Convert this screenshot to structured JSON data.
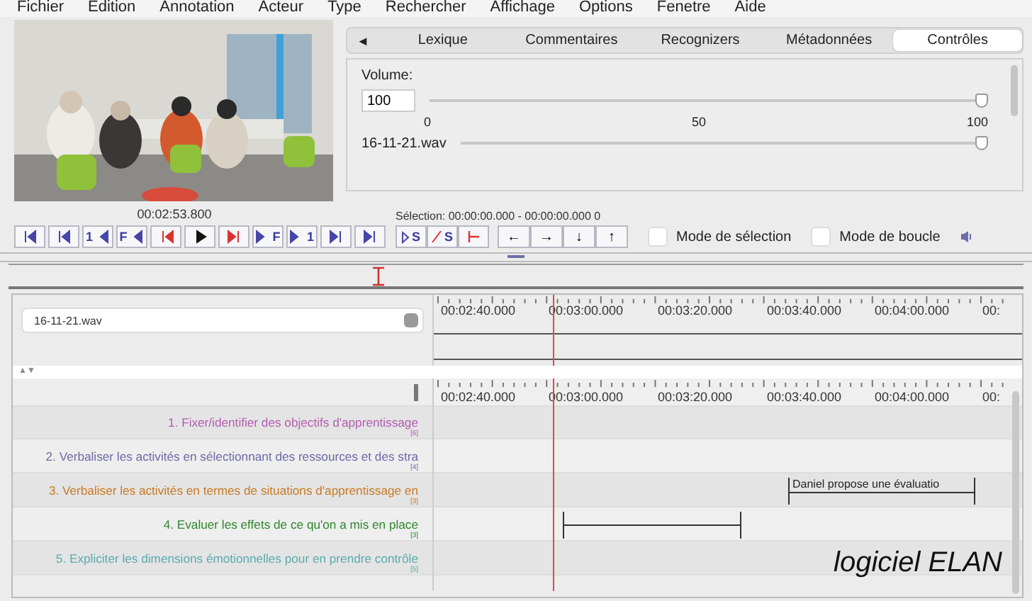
{
  "menu": [
    "Fichier",
    "Edition",
    "Annotation",
    "Acteur",
    "Type",
    "Rechercher",
    "Affichage",
    "Options",
    "Fenetre",
    "Aide"
  ],
  "player": {
    "time": "00:02:53.800",
    "buttons": [
      {
        "kind": "first"
      },
      {
        "kind": "prev-second"
      },
      {
        "kind": "prev-step",
        "label": "1"
      },
      {
        "kind": "prev-frame",
        "label": "F"
      },
      {
        "kind": "prev-boundary"
      },
      {
        "kind": "play"
      },
      {
        "kind": "next-boundary"
      },
      {
        "kind": "next-frame",
        "label": "F"
      },
      {
        "kind": "next-step",
        "label": "1"
      },
      {
        "kind": "next-second"
      },
      {
        "kind": "last"
      }
    ]
  },
  "tabs": [
    {
      "label": "Lexique",
      "selected": false
    },
    {
      "label": "Commentaires",
      "selected": false
    },
    {
      "label": "Recognizers",
      "selected": false
    },
    {
      "label": "Métadonnées",
      "selected": false
    },
    {
      "label": "Contrôles",
      "selected": true
    }
  ],
  "tab_scroll": "◄",
  "volume": {
    "label": "Volume:",
    "value": "100",
    "level": 1,
    "tick_labels": [
      "0",
      "50",
      "100"
    ]
  },
  "audio_file": {
    "name": "16-11-21.wav",
    "level": 1
  },
  "selection": {
    "text": "Sélection: 00:00:00.000 - 00:00:00.000 0",
    "buttons": [
      {
        "kind": "play-selection",
        "label": "S"
      },
      {
        "kind": "clear-selection",
        "label": "S"
      },
      {
        "kind": "to-start"
      }
    ],
    "arrows": [
      "←",
      "→",
      "↓",
      "↑"
    ]
  },
  "modes": [
    {
      "label": "Mode de sélection",
      "checked": false
    },
    {
      "label": "Mode de boucle",
      "checked": false
    }
  ],
  "media_select": {
    "value": "16-11-21.wav"
  },
  "waveform_ruler": [
    "00:02:40.000",
    "00:03:00.000",
    "00:03:20.000",
    "00:03:40.000",
    "00:04:00.000",
    "00:"
  ],
  "tier_ruler": [
    "00:02:40.000",
    "00:03:00.000",
    "00:03:20.000",
    "00:03:40.000",
    "00:04:00.000",
    "00:"
  ],
  "sort_arrows": "▲▼",
  "tiers": [
    {
      "name": "1. Fixer/identifier des objectifs d'apprentissage",
      "count": "[6]",
      "color": "#b35bb0"
    },
    {
      "name": "2. Verbaliser les activités en sélectionnant des ressources et des stra",
      "count": "[4]",
      "color": "#6b6aa6"
    },
    {
      "name": "3. Verbaliser les activités en termes de situations d'apprentissage en",
      "count": "[3]",
      "color": "#c77a22",
      "annotations": [
        {
          "kind": "labeled",
          "text": "Daniel propose une évaluatio"
        }
      ]
    },
    {
      "name": "4. Evaluer les effets de ce qu'on a mis en place",
      "count": "[3]",
      "color": "#2f862f",
      "annotations": [
        {
          "kind": "segment"
        }
      ]
    },
    {
      "name": "5. Expliciter les dimensions émotionnelles pour en prendre contrôle",
      "count": "[5]",
      "color": "#5aaab0"
    }
  ],
  "caption": "logiciel ELAN"
}
